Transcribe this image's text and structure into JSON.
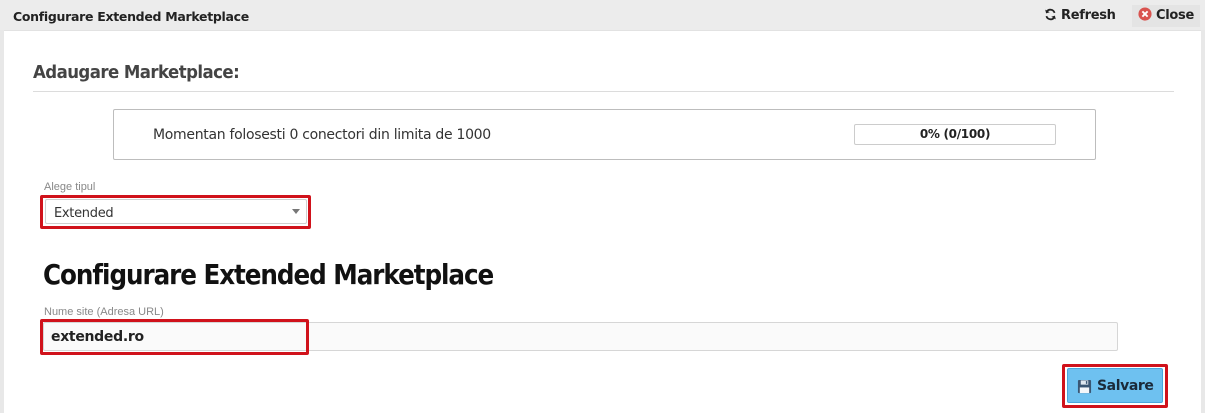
{
  "window": {
    "title": "Configurare Extended Marketplace",
    "refresh_label": "Refresh",
    "close_label": "Close",
    "refresh_icon": "refresh-icon",
    "close_icon": "close-circle-icon",
    "close_icon_color": "#d9534f"
  },
  "section": {
    "heading": "Adaugare Marketplace:"
  },
  "usage": {
    "text": "Momentan folosesti 0 conectori din limita de 1000",
    "progress_label": "0% (0/100)",
    "progress_fraction": 0
  },
  "type_select": {
    "label": "Alege tipul",
    "value": "Extended"
  },
  "config": {
    "heading": "Configurare Extended Marketplace",
    "site_label": "Nume site (Adresa URL)",
    "site_value": "extended.ro"
  },
  "actions": {
    "save_label": "Salvare",
    "save_icon": "floppy-disk-icon"
  },
  "colors": {
    "highlight": "#d0121b",
    "save_button": "#6ec1f0"
  }
}
